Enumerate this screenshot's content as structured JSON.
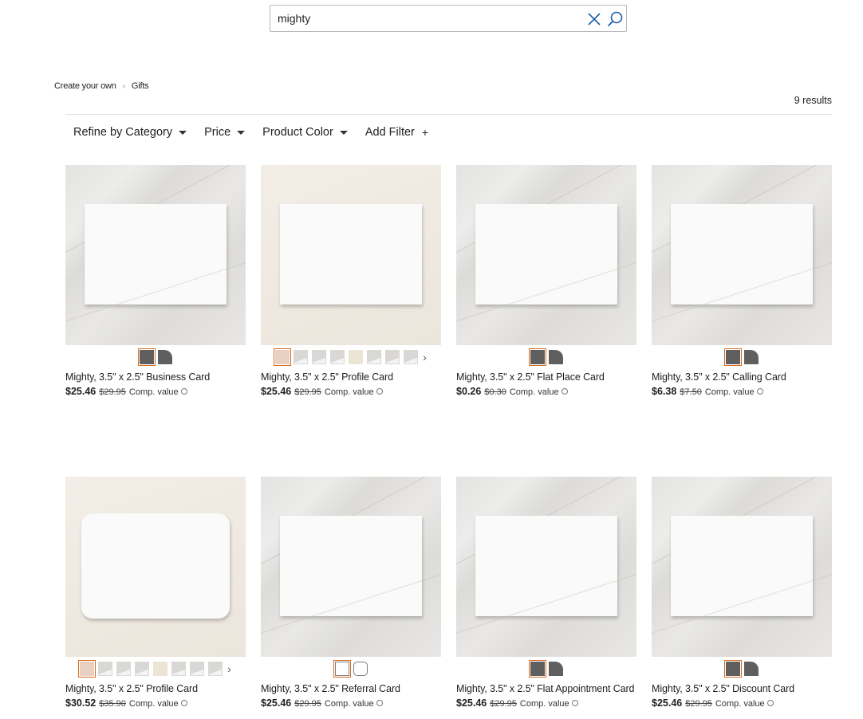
{
  "search": {
    "value": "mighty"
  },
  "breadcrumb": [
    {
      "label": "Create your own"
    },
    {
      "label": "Gifts"
    }
  ],
  "results": {
    "count_text": "9 results"
  },
  "filters": [
    {
      "label": "Refine by Category",
      "icon": "caret-down-icon"
    },
    {
      "label": "Price",
      "icon": "caret-down-icon"
    },
    {
      "label": "Product Color",
      "icon": "caret-down-icon"
    },
    {
      "label": "Add Filter",
      "icon": "plus-icon"
    }
  ],
  "colors": {
    "selected_outline": "#d96a1d",
    "swatch_dark": "#5f5f5f"
  },
  "comp_label": "Comp. value",
  "products": [
    {
      "title": "Mighty, 3.5\" x 2.5\" Business Card",
      "price": "$25.46",
      "original_price": "$29.95",
      "background": "marble",
      "card_shape": "square",
      "swatches": [
        "dark",
        "dark-round"
      ],
      "more": false
    },
    {
      "title": "Mighty, 3.5\" x 2.5\" Profile Card",
      "price": "$25.46",
      "original_price": "$29.95",
      "background": "cream",
      "card_shape": "square",
      "swatches": [
        "peach",
        "light",
        "light",
        "light",
        "cream",
        "light",
        "light",
        "light"
      ],
      "more": true
    },
    {
      "title": "Mighty, 3.5\" x 2.5\" Flat Place Card",
      "price": "$0.26",
      "original_price": "$0.30",
      "background": "marble",
      "card_shape": "square",
      "swatches": [
        "dark",
        "dark-round"
      ],
      "more": false
    },
    {
      "title": "Mighty, 3.5\" x 2.5\" Calling Card",
      "price": "$6.38",
      "original_price": "$7.50",
      "background": "marble",
      "card_shape": "square",
      "swatches": [
        "dark",
        "dark-round"
      ],
      "more": false
    },
    {
      "title": "Mighty, 3.5\" x 2.5\" Profile Card",
      "price": "$30.52",
      "original_price": "$35.90",
      "background": "cream",
      "card_shape": "rounded",
      "swatches": [
        "peach",
        "light",
        "light",
        "light",
        "cream",
        "light",
        "light",
        "light"
      ],
      "more": true
    },
    {
      "title": "Mighty, 3.5\" x 2.5\" Referral Card",
      "price": "$25.46",
      "original_price": "$29.95",
      "background": "marble",
      "card_shape": "square",
      "swatches": [
        "white",
        "white-round"
      ],
      "more": false
    },
    {
      "title": "Mighty, 3.5\" x 2.5\" Flat Appointment Card",
      "price": "$25.46",
      "original_price": "$29.95",
      "background": "marble",
      "card_shape": "square",
      "swatches": [
        "dark",
        "dark-round"
      ],
      "more": false
    },
    {
      "title": "Mighty, 3.5\" x 2.5\" Discount Card",
      "price": "$25.46",
      "original_price": "$29.95",
      "background": "marble",
      "card_shape": "square",
      "swatches": [
        "dark",
        "dark-round"
      ],
      "more": false
    }
  ]
}
